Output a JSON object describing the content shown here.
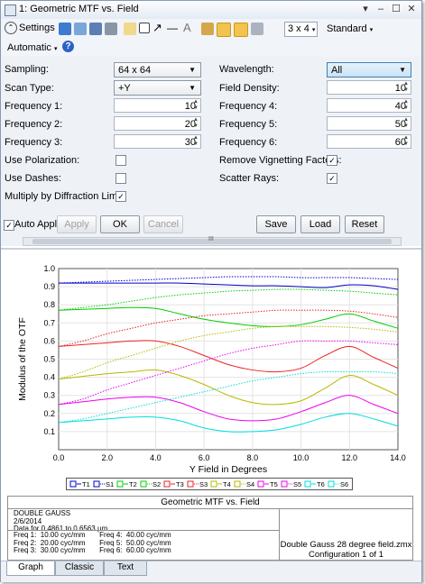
{
  "window": {
    "title": "1: Geometric MTF vs. Field",
    "min": "–",
    "max": "☐",
    "close": "✕",
    "pin": "▾"
  },
  "toolbar": {
    "settings_label": "Settings",
    "layout_value": "3 x 4",
    "standard_label": "Standard",
    "automatic_label": "Automatic",
    "help": "?"
  },
  "settings": {
    "sampling_label": "Sampling:",
    "sampling_value": "64 x 64",
    "scan_type_label": "Scan Type:",
    "scan_type_value": "+Y",
    "freq1_label": "Frequency 1:",
    "freq1_value": "10",
    "freq2_label": "Frequency 2:",
    "freq2_value": "20",
    "freq3_label": "Frequency 3:",
    "freq3_value": "30",
    "use_polarization_label": "Use Polarization:",
    "use_dashes_label": "Use Dashes:",
    "multiply_diffraction_label": "Multiply by Diffraction Limit:",
    "wavelength_label": "Wavelength:",
    "wavelength_value": "All",
    "field_density_label": "Field Density:",
    "field_density_value": "10",
    "freq4_label": "Frequency 4:",
    "freq4_value": "40",
    "freq5_label": "Frequency 5:",
    "freq5_value": "50",
    "freq6_label": "Frequency 6:",
    "freq6_value": "60",
    "remove_vignetting_label": "Remove Vignetting Factors:",
    "scatter_rays_label": "Scatter Rays:",
    "check_mark": "✓"
  },
  "buttons": {
    "auto_apply": "Auto Apply",
    "apply": "Apply",
    "ok": "OK",
    "cancel": "Cancel",
    "save": "Save",
    "load": "Load",
    "reset": "Reset",
    "scroll_grip": "III"
  },
  "chart_data": {
    "type": "line",
    "xlabel": "Y Field in Degrees",
    "ylabel": "Modulus of the OTF",
    "xlim": [
      0,
      14
    ],
    "ylim": [
      0,
      1
    ],
    "x_ticks": [
      "0.0",
      "2.0",
      "4.0",
      "6.0",
      "8.0",
      "10.0",
      "12.0",
      "14.0"
    ],
    "y_ticks": [
      "0.1",
      "0.2",
      "0.3",
      "0.4",
      "0.5",
      "0.6",
      "0.7",
      "0.8",
      "0.9",
      "1.0"
    ],
    "grid": true,
    "legend_position": "bottom",
    "x": [
      0,
      1,
      2,
      3,
      4,
      5,
      6,
      7,
      8,
      9,
      10,
      11,
      12,
      13,
      14
    ],
    "series": [
      {
        "name": "T1",
        "color": "#0000cc",
        "dashed": false,
        "values": [
          0.92,
          0.92,
          0.92,
          0.92,
          0.92,
          0.92,
          0.915,
          0.91,
          0.905,
          0.905,
          0.9,
          0.895,
          0.91,
          0.905,
          0.885
        ]
      },
      {
        "name": "S1",
        "color": "#0000cc",
        "dashed": true,
        "values": [
          0.92,
          0.925,
          0.93,
          0.935,
          0.94,
          0.945,
          0.95,
          0.955,
          0.955,
          0.955,
          0.95,
          0.95,
          0.95,
          0.945,
          0.94
        ]
      },
      {
        "name": "T2",
        "color": "#00cc00",
        "dashed": false,
        "values": [
          0.77,
          0.775,
          0.78,
          0.785,
          0.78,
          0.75,
          0.72,
          0.7,
          0.685,
          0.68,
          0.69,
          0.72,
          0.75,
          0.71,
          0.67
        ]
      },
      {
        "name": "S2",
        "color": "#00cc00",
        "dashed": true,
        "values": [
          0.77,
          0.785,
          0.8,
          0.82,
          0.84,
          0.855,
          0.865,
          0.875,
          0.88,
          0.885,
          0.885,
          0.88,
          0.875,
          0.865,
          0.855
        ]
      },
      {
        "name": "T3",
        "color": "#ee2222",
        "dashed": false,
        "values": [
          0.57,
          0.58,
          0.59,
          0.6,
          0.6,
          0.57,
          0.52,
          0.47,
          0.44,
          0.43,
          0.45,
          0.52,
          0.57,
          0.51,
          0.45
        ]
      },
      {
        "name": "S3",
        "color": "#ee2222",
        "dashed": true,
        "values": [
          0.57,
          0.6,
          0.64,
          0.67,
          0.7,
          0.72,
          0.74,
          0.75,
          0.76,
          0.77,
          0.77,
          0.77,
          0.765,
          0.75,
          0.73
        ]
      },
      {
        "name": "T4",
        "color": "#b8b800",
        "dashed": false,
        "values": [
          0.39,
          0.405,
          0.42,
          0.43,
          0.44,
          0.41,
          0.36,
          0.3,
          0.26,
          0.25,
          0.27,
          0.34,
          0.41,
          0.36,
          0.3
        ]
      },
      {
        "name": "S4",
        "color": "#b8b800",
        "dashed": true,
        "values": [
          0.39,
          0.43,
          0.48,
          0.52,
          0.56,
          0.6,
          0.63,
          0.65,
          0.67,
          0.68,
          0.68,
          0.68,
          0.675,
          0.665,
          0.65
        ]
      },
      {
        "name": "T5",
        "color": "#ee00ee",
        "dashed": false,
        "values": [
          0.25,
          0.265,
          0.28,
          0.29,
          0.29,
          0.26,
          0.21,
          0.17,
          0.16,
          0.17,
          0.21,
          0.26,
          0.3,
          0.25,
          0.2
        ]
      },
      {
        "name": "S5",
        "color": "#ee00ee",
        "dashed": true,
        "values": [
          0.25,
          0.28,
          0.33,
          0.37,
          0.41,
          0.45,
          0.49,
          0.53,
          0.56,
          0.58,
          0.6,
          0.6,
          0.6,
          0.59,
          0.58
        ]
      },
      {
        "name": "T6",
        "color": "#00dddd",
        "dashed": false,
        "values": [
          0.15,
          0.16,
          0.17,
          0.18,
          0.18,
          0.16,
          0.12,
          0.1,
          0.1,
          0.11,
          0.14,
          0.18,
          0.2,
          0.17,
          0.13
        ]
      },
      {
        "name": "S6",
        "color": "#00dddd",
        "dashed": true,
        "values": [
          0.15,
          0.17,
          0.2,
          0.23,
          0.26,
          0.29,
          0.32,
          0.35,
          0.38,
          0.4,
          0.42,
          0.43,
          0.43,
          0.43,
          0.42
        ]
      }
    ]
  },
  "info": {
    "header": "Geometric MTF vs. Field",
    "left_text": "DOUBLE GAUSS\n2/6/2014\nData for 0.4861 to 0.6563 µm.",
    "freq_text": "Freq 1:  10.00 cyc/mm       Freq 4:  40.00 cyc/mm\nFreq 2:  20.00 cyc/mm       Freq 5:  50.00 cyc/mm\nFreq 3:  30.00 cyc/mm       Freq 6:  60.00 cyc/mm",
    "file_line": "Double Gauss 28 degree field.zmx",
    "config_line": "Configuration 1 of 1"
  },
  "tabs": [
    "Graph",
    "Classic",
    "Text"
  ]
}
